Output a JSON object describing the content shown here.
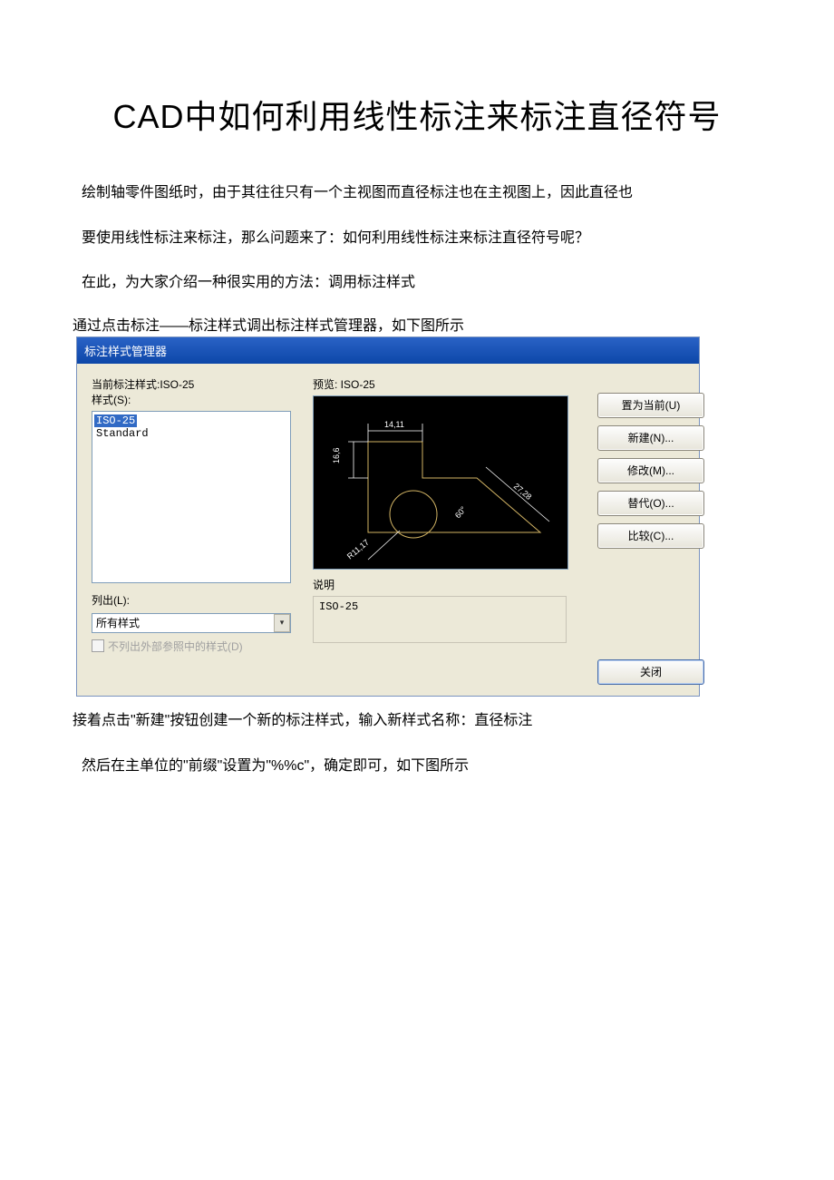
{
  "title": "CAD中如何利用线性标注来标注直径符号",
  "para1": "绘制轴零件图纸时，由于其往往只有一个主视图而直径标注也在主视图上，因此直径也",
  "para2": "要使用线性标注来标注，那么问题来了：如何利用线性标注来标注直径符号呢？",
  "para3": "在此，为大家介绍一种很实用的方法：调用标注样式",
  "para4": "通过点击标注——标注样式调出标注样式管理器，如下图所示",
  "dlg": {
    "titlebar": "标注样式管理器",
    "current_label": "当前标注样式:ISO-25",
    "styles_label": "样式(S):",
    "preview_label": "预览: ISO-25",
    "items": [
      "ISO-25",
      "Standard"
    ],
    "list_label": "列出(L):",
    "list_value": "所有样式",
    "chk_label": "不列出外部参照中的样式(D)",
    "desc_label": "说明",
    "desc_value": "ISO-25",
    "btn_setcurrent": "置为当前(U)",
    "btn_new": "新建(N)...",
    "btn_modify": "修改(M)...",
    "btn_override": "替代(O)...",
    "btn_compare": "比较(C)...",
    "btn_close": "关闭",
    "pv": {
      "top": "14,11",
      "left": "16,6",
      "diag": "27,28",
      "ang": "60°",
      "rad": "R11,17"
    }
  },
  "para5": "接着点击\"新建\"按钮创建一个新的标注样式，输入新样式名称：直径标注",
  "para6": "然后在主单位的\"前缀\"设置为\"%%c\"，确定即可，如下图所示"
}
